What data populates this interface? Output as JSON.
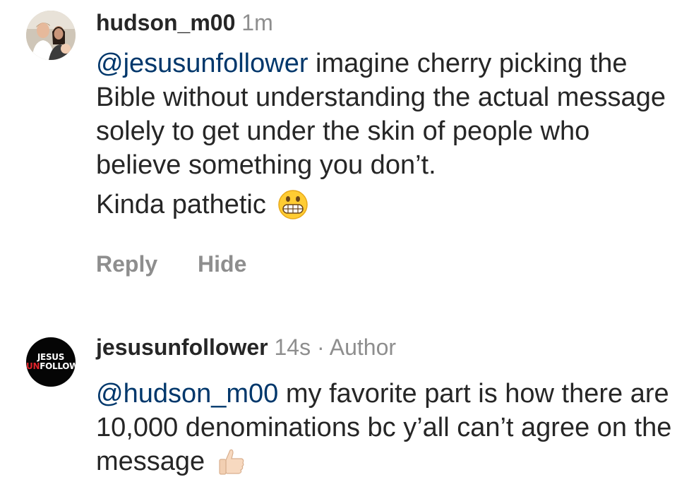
{
  "comments": [
    {
      "username": "hudson_m00",
      "meta": "1m",
      "mention": "@jesusunfollower",
      "text": " imagine cherry picking the Bible without understanding the actual message solely to get under the skin of people who believe something you don’t.",
      "text2": "Kinda pathetic",
      "emoji": "grimacing-face-emoji",
      "actions": {
        "reply": "Reply",
        "hide": "Hide"
      }
    },
    {
      "username": "jesusunfollower",
      "meta": "14s · Author",
      "mention": "@hudson_m00",
      "text": " my favorite part is how there are 10,000 denominations bc y’all can’t agree on the message",
      "emoji": "thumbs-up-emoji",
      "logo": {
        "line1": "JESUS",
        "line2a": "UN",
        "line2b": "FOLLOWER"
      }
    }
  ],
  "colors": {
    "mention": "#00376b",
    "muted": "#8e8e8e",
    "text": "#262626",
    "logo_accent": "#e0242b"
  }
}
